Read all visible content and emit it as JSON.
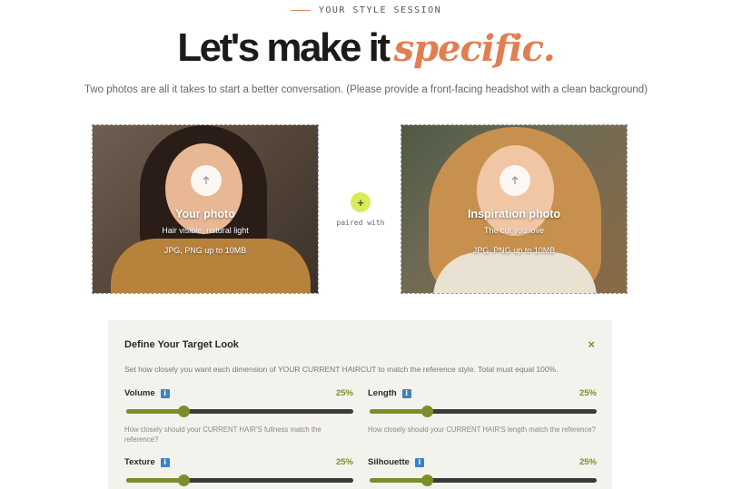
{
  "header": {
    "eyebrow": "YOUR STYLE SESSION",
    "headline_plain": "Let's make it",
    "headline_accent": "specific.",
    "subtitle": "Two photos are all it takes to start a better conversation. (Please provide a front-facing headshot with a clean background)"
  },
  "uploads": {
    "your_photo": {
      "title": "Your photo",
      "subtitle": "Hair visible, natural light",
      "formats": "JPG, PNG up to 10MB",
      "icon": "upload-icon"
    },
    "inspiration_photo": {
      "title": "Inspiration photo",
      "subtitle": "The cut you love",
      "formats": "JPG, PNG up to 10MB",
      "icon": "upload-icon"
    },
    "pair_plus": "+",
    "pair_label": "paired with"
  },
  "panel": {
    "title": "Define Your Target Look",
    "close": "×",
    "description": "Set how closely you want each dimension of YOUR CURRENT HAIRCUT to match the reference style. Total must equal 100%.",
    "dimensions": [
      {
        "label": "Volume",
        "info": "i",
        "percent_text": "25%",
        "value": 25,
        "hint": "How closely should your CURRENT HAIR'S fullness match the reference?"
      },
      {
        "label": "Length",
        "info": "i",
        "percent_text": "25%",
        "value": 25,
        "hint": "How closely should your CURRENT HAIR'S length match the reference?"
      },
      {
        "label": "Texture",
        "info": "i",
        "percent_text": "25%",
        "value": 25,
        "hint": ""
      },
      {
        "label": "Silhouette",
        "info": "i",
        "percent_text": "25%",
        "value": 25,
        "hint": ""
      }
    ]
  },
  "colors": {
    "accent_orange": "#e07f52",
    "accent_green": "#7a8f2a",
    "pair_plus_bg": "#d8ec5a",
    "info_blue": "#3b82c4"
  }
}
